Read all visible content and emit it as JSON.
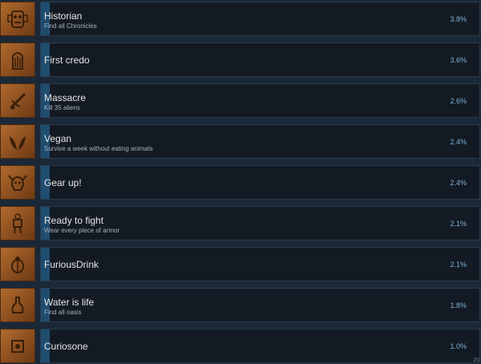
{
  "achievements": [
    {
      "title": "Historian",
      "description": "Find all Chronicles",
      "percent": "3.8%",
      "percent_value": 3.8,
      "icon": "mask-icon"
    },
    {
      "title": "First credo",
      "description": "",
      "percent": "3.6%",
      "percent_value": 3.6,
      "icon": "tablet-icon"
    },
    {
      "title": "Massacre",
      "description": "Kill 35 aliens",
      "percent": "2.6%",
      "percent_value": 2.6,
      "icon": "weapon-icon"
    },
    {
      "title": "Vegan",
      "description": "Survive a week without eating animals",
      "percent": "2.4%",
      "percent_value": 2.4,
      "icon": "leaves-icon"
    },
    {
      "title": "Gear up!",
      "description": "",
      "percent": "2.4%",
      "percent_value": 2.4,
      "icon": "helmet-icon"
    },
    {
      "title": "Ready to fight",
      "description": "Wear every piece of armor",
      "percent": "2.1%",
      "percent_value": 2.1,
      "icon": "armor-icon"
    },
    {
      "title": "FuriousDrink",
      "description": "",
      "percent": "2.1%",
      "percent_value": 2.1,
      "icon": "beetle-icon"
    },
    {
      "title": "Water is life",
      "description": "Find all oasis",
      "percent": "1.8%",
      "percent_value": 1.8,
      "icon": "flask-icon"
    },
    {
      "title": "Curiosone",
      "description": "",
      "percent": "1.0%",
      "percent_value": 1.0,
      "icon": "relic-icon"
    }
  ],
  "corner_label": "20",
  "colors": {
    "icon_bg": "#a25f28",
    "panel_bg": "#131a23",
    "bar": "#1f4d70",
    "percent_text": "#7fb2d8"
  }
}
